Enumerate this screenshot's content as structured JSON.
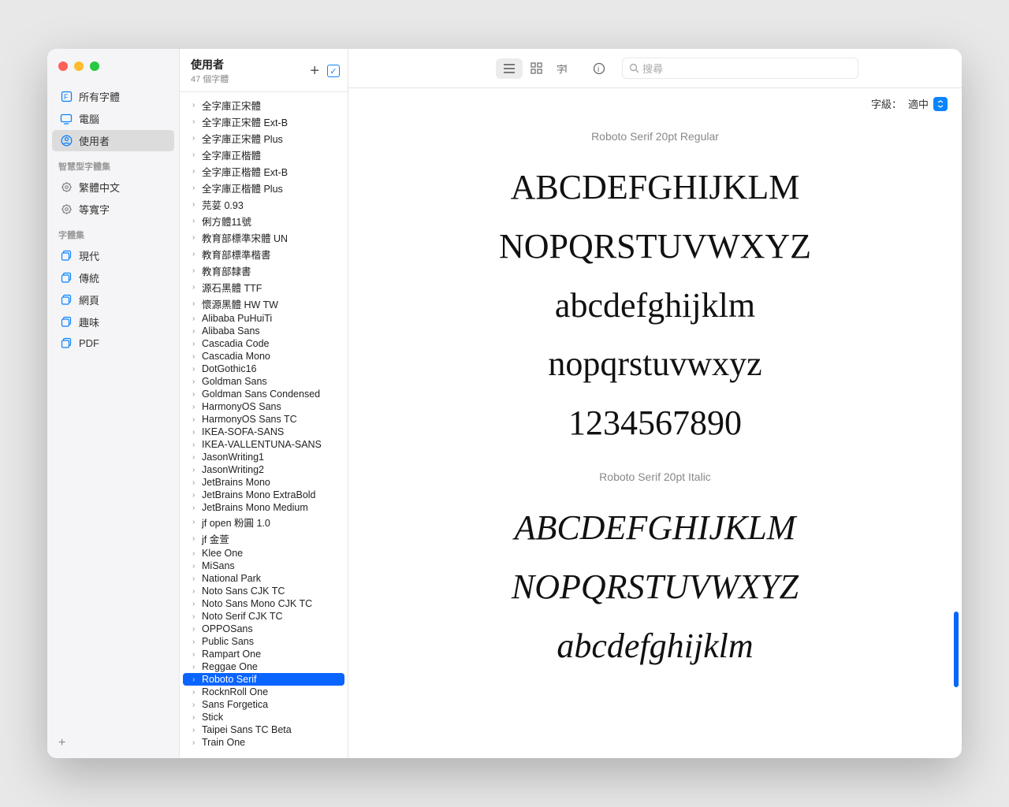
{
  "sidebar": {
    "items": [
      {
        "label": "所有字體",
        "icon": "text-square"
      },
      {
        "label": "電腦",
        "icon": "display"
      },
      {
        "label": "使用者",
        "icon": "person-circle",
        "selected": true
      }
    ],
    "smart_header": "智慧型字體集",
    "smart_items": [
      {
        "label": "繁體中文",
        "icon": "gear"
      },
      {
        "label": "等寬字",
        "icon": "gear"
      }
    ],
    "coll_header": "字體集",
    "coll_items": [
      {
        "label": "現代",
        "icon": "square-stack"
      },
      {
        "label": "傳統",
        "icon": "square-stack"
      },
      {
        "label": "網頁",
        "icon": "square-stack"
      },
      {
        "label": "趣味",
        "icon": "square-stack"
      },
      {
        "label": "PDF",
        "icon": "square-stack"
      }
    ]
  },
  "fontlist": {
    "title": "使用者",
    "subtitle": "47 個字體",
    "items": [
      "全字庫正宋體",
      "全字庫正宋體 Ext-B",
      "全字庫正宋體 Plus",
      "全字庫正楷體",
      "全字庫正楷體 Ext-B",
      "全字庫正楷體 Plus",
      "芫荽 0.93",
      "俐方體11號",
      "教育部標準宋體 UN",
      "教育部標準楷書",
      "教育部隸書",
      "源石黑體 TTF",
      "懷源黑體 HW TW",
      "Alibaba PuHuiTi",
      "Alibaba Sans",
      "Cascadia Code",
      "Cascadia Mono",
      "DotGothic16",
      "Goldman Sans",
      "Goldman Sans Condensed",
      "HarmonyOS Sans",
      "HarmonyOS Sans TC",
      "IKEA-SOFA-SANS",
      "IKEA-VALLENTUNA-SANS",
      "JasonWriting1",
      "JasonWriting2",
      "JetBrains Mono",
      "JetBrains Mono ExtraBold",
      "JetBrains Mono Medium",
      "jf open 粉圓 1.0",
      "jf 金萱",
      "Klee One",
      "MiSans",
      "National Park",
      "Noto Sans CJK TC",
      "Noto Sans Mono CJK TC",
      "Noto Serif CJK TC",
      "OPPOSans",
      "Public Sans",
      "Rampart One",
      "Reggae One",
      "Roboto Serif",
      "RocknRoll One",
      "Sans Forgetica",
      "Stick",
      "Taipei Sans TC Beta",
      "Train One"
    ],
    "selected": "Roboto Serif"
  },
  "toolbar": {
    "search_placeholder": "搜尋"
  },
  "size": {
    "label": "字級：",
    "value": "適中"
  },
  "preview": {
    "blocks": [
      {
        "name": "Roboto Serif 20pt Regular",
        "style": "normal",
        "lines": [
          "ABCDEFGHIJKLM",
          "NOPQRSTUVWXYZ",
          "abcdefghijklm",
          "nopqrstuvwxyz",
          "1234567890"
        ]
      },
      {
        "name": "Roboto Serif 20pt Italic",
        "style": "italic",
        "lines": [
          "ABCDEFGHIJKLM",
          "NOPQRSTUVWXYZ",
          "abcdefghijklm"
        ]
      }
    ]
  }
}
